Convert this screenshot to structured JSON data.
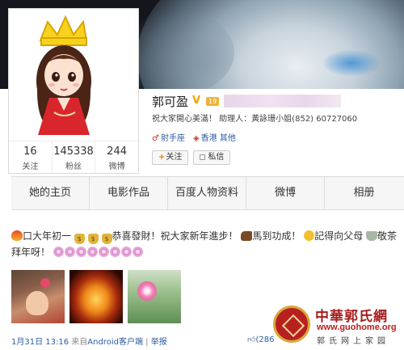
{
  "profile": {
    "name": "郭可盈",
    "level_badge": "19",
    "bio": "祝大家開心美滿！ 助理人：黃詠珊小姐(852) 60727060",
    "tags": [
      "射手座",
      "香港 其他"
    ],
    "follow_label": "关注",
    "message_label": "私信",
    "stats": [
      {
        "num": "16",
        "label": "关注"
      },
      {
        "num": "145338",
        "label": "粉丝"
      },
      {
        "num": "244",
        "label": "微博"
      }
    ]
  },
  "tabs": [
    "她的主页",
    "电影作品",
    "百度人物资料",
    "微博",
    "相册"
  ],
  "post": {
    "seg1": "口大年初一",
    "seg2": "恭喜發財！祝大家新年進步！",
    "seg3": "馬到功成！",
    "seg4": "記得向父母",
    "seg5": "敬茶",
    "seg6": "拜年呀！",
    "meta_date": "1月31日 13:16",
    "meta_from": "来自",
    "meta_source": "Android客户端",
    "meta_sep": "|",
    "meta_report": "举报",
    "like_count": "286"
  },
  "watermark": {
    "title": "中華郭氏網",
    "url": "www.guohome.org",
    "subtitle": "郭氏网上家园"
  },
  "colors": {
    "link": "#2d5c9e",
    "accent": "#e67e00",
    "seal": "#b8201f"
  },
  "icons": [
    "verified-v-icon",
    "fortune-bag-icon",
    "horse-icon",
    "smile-face-icon",
    "tea-cup-icon",
    "flower-icon",
    "like-thumb-icon"
  ]
}
